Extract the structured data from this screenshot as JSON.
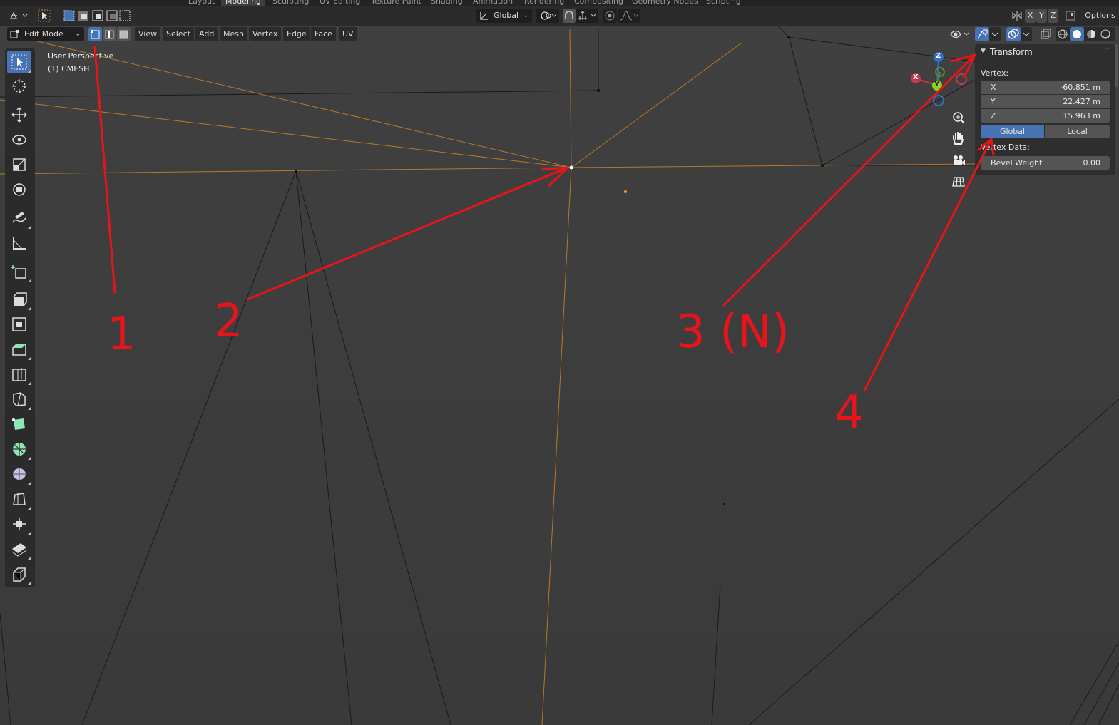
{
  "workspace_tabs": [
    "Layout",
    "Modeling",
    "Sculpting",
    "UV Editing",
    "Texture Paint",
    "Shading",
    "Animation",
    "Rendering",
    "Compositing",
    "Geometry Nodes",
    "Scripting"
  ],
  "header": {
    "orientation_label": "Global",
    "axes": [
      "X",
      "Y",
      "Z"
    ],
    "options_label": "Options"
  },
  "view_header": {
    "mode_label": "Edit Mode",
    "menus": [
      "View",
      "Select",
      "Add",
      "Mesh",
      "Vertex",
      "Edge",
      "Face",
      "UV"
    ]
  },
  "viewport": {
    "perspective_label": "User Perspective",
    "object_label": "(1) CMESH"
  },
  "gizmo": {
    "x": "X",
    "y": "Y",
    "z": "Z"
  },
  "npanel": {
    "title": "Transform",
    "vertex_label": "Vertex:",
    "fields": [
      {
        "label": "X",
        "value": "-60.851 m"
      },
      {
        "label": "Y",
        "value": "22.427 m"
      },
      {
        "label": "Z",
        "value": "15.963 m"
      }
    ],
    "space_options": [
      "Global",
      "Local"
    ],
    "space_selected": "Global",
    "vertex_data_label": "Vertex Data:",
    "bevel_label": "Bevel Weight",
    "bevel_value": "0.00"
  },
  "annotations": [
    "1",
    "2",
    "3 (N)",
    "4"
  ],
  "colors": {
    "accent": "#4772b3",
    "selected_edge": "#b8782a",
    "annotation_red": "#e8141a"
  }
}
